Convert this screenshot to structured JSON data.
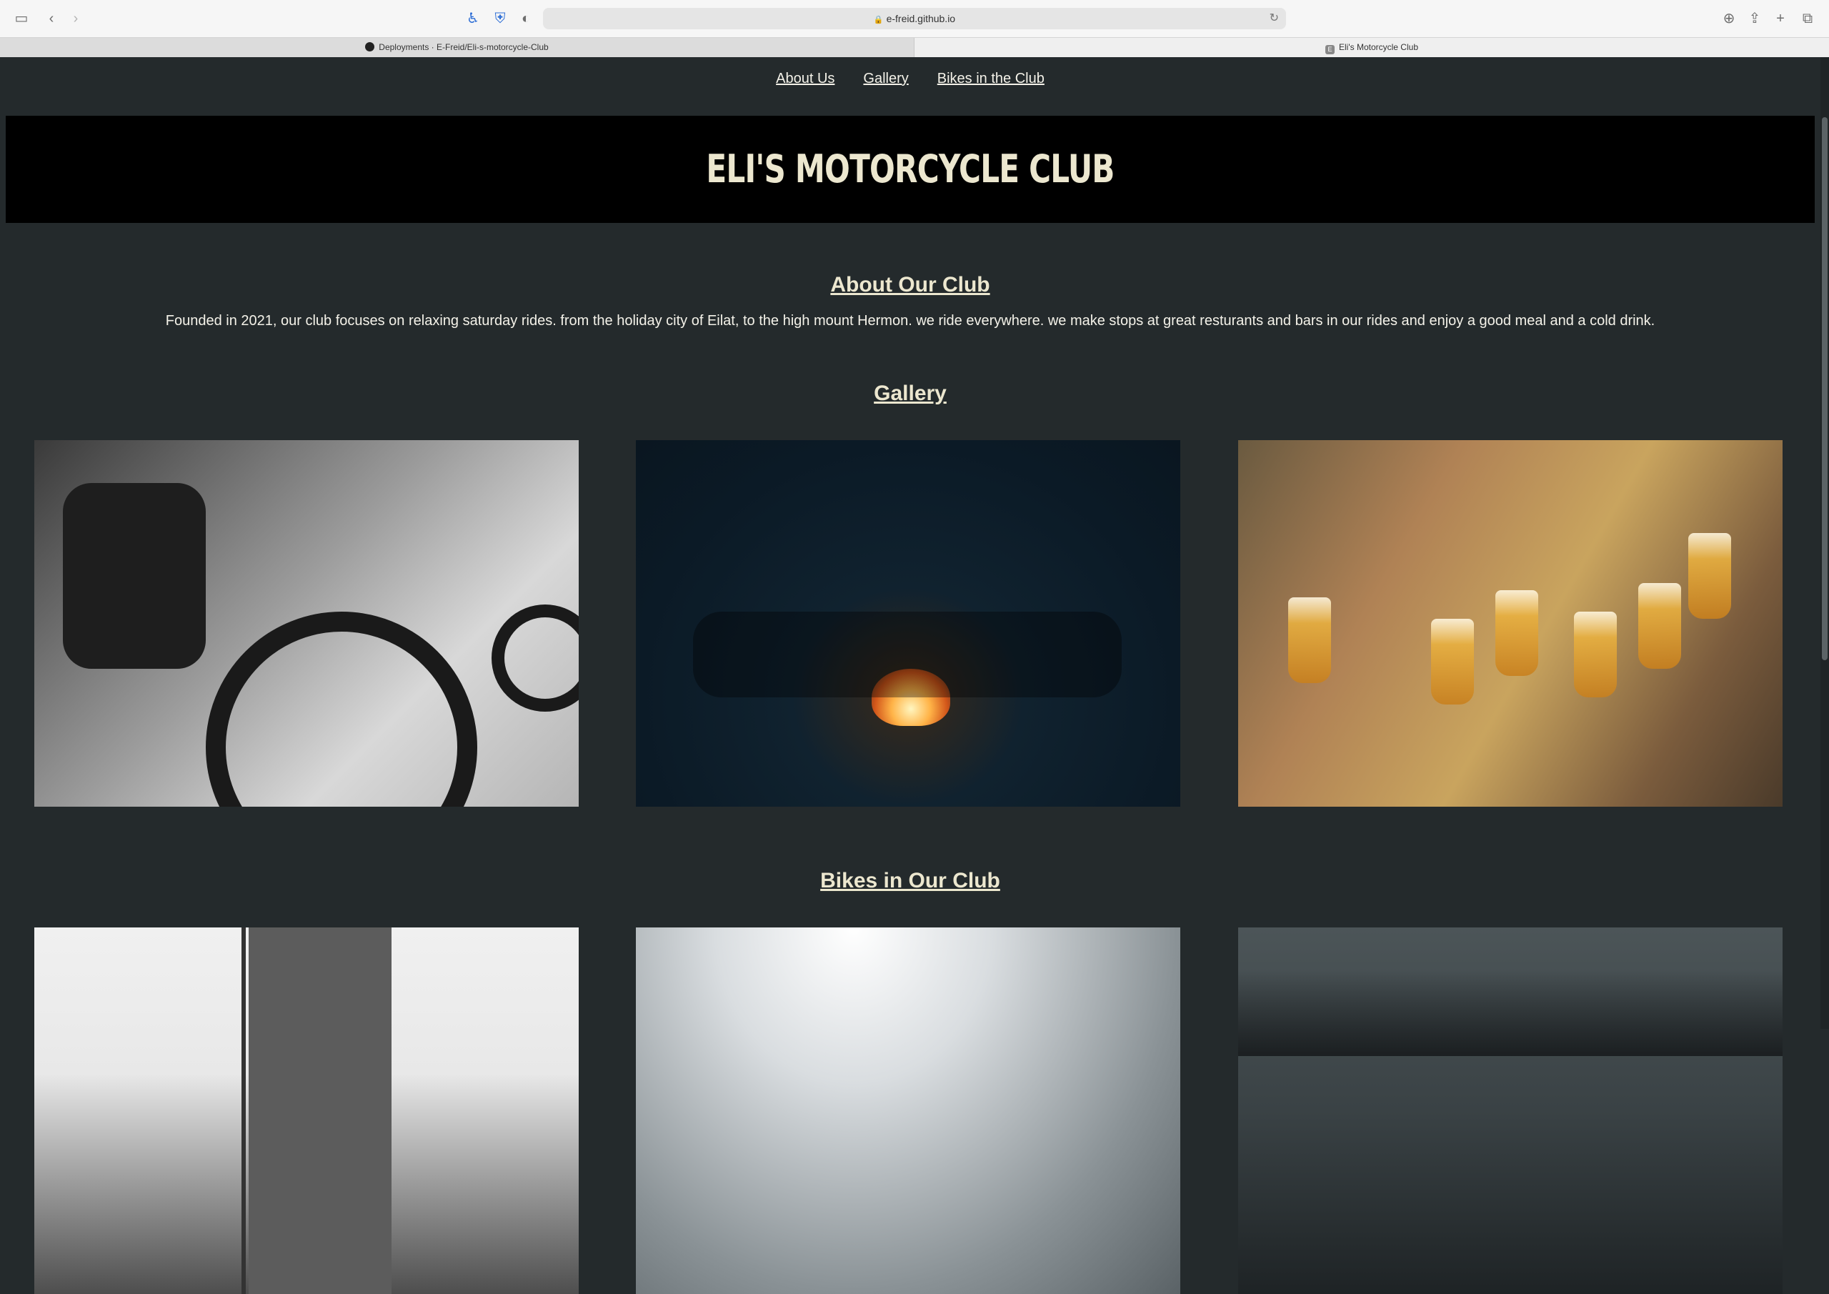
{
  "browser": {
    "url": "e-freid.github.io",
    "tabs": [
      {
        "label": "Deployments · E-Freid/Eli-s-motorcycle-Club"
      },
      {
        "label": "Eli's Motorcycle Club"
      }
    ]
  },
  "nav": {
    "links": [
      {
        "label": "About Us"
      },
      {
        "label": "Gallery"
      },
      {
        "label": "Bikes in the Club"
      }
    ]
  },
  "header": {
    "title": "ELI'S MOTORCYCLE CLUB"
  },
  "about": {
    "heading": "About Our Club",
    "text": "Founded in 2021, our club focuses on relaxing saturday rides. from the holiday city of Eilat, to the high mount Hermon. we ride everywhere. we make stops at great resturants and bars in our rides and enjoy a good meal and a cold drink."
  },
  "gallery": {
    "heading": "Gallery"
  },
  "bikes": {
    "heading": "Bikes in Our Club"
  },
  "colors": {
    "page_background": "#242a2c",
    "header_background": "#000000",
    "heading_text": "#ece7cf",
    "body_text": "#f4f2e9"
  }
}
